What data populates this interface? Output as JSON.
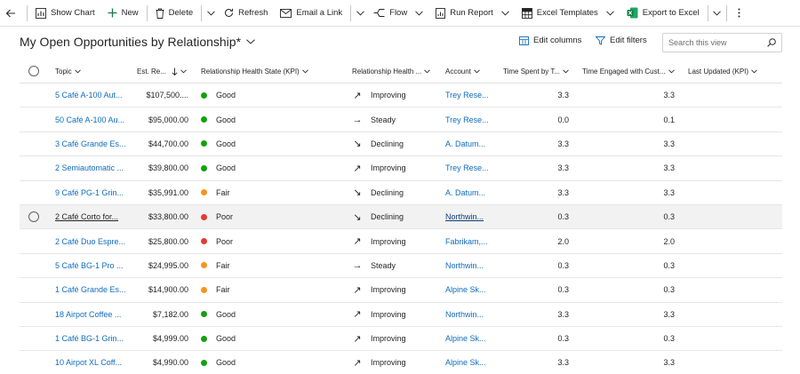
{
  "toolbar": {
    "show_chart": "Show Chart",
    "new": "New",
    "delete": "Delete",
    "refresh": "Refresh",
    "email_link": "Email a Link",
    "flow": "Flow",
    "run_report": "Run Report",
    "excel_templates": "Excel Templates",
    "export_excel": "Export to Excel"
  },
  "header": {
    "title": "My Open Opportunities by Relationship*",
    "edit_columns": "Edit columns",
    "edit_filters": "Edit filters",
    "search_placeholder": "Search this view"
  },
  "columns": {
    "topic": "Topic",
    "est_revenue": "Est. Re...",
    "health_state": "Relationship Health State (KPI)",
    "health_trend": "Relationship Health ...",
    "account": "Account",
    "time_spent": "Time Spent by T...",
    "time_engaged": "Time Engaged with Cust...",
    "last_updated": "Last Updated (KPI)"
  },
  "colors": {
    "good": "#13a10e",
    "fair": "#f7941d",
    "poor": "#e53935",
    "link": "#0f6cbd",
    "excel_green": "#107c41"
  },
  "rows": [
    {
      "topic": "5 Café A-100 Aut...",
      "revenue": "$107,500....",
      "health": "Good",
      "health_color": "#13a10e",
      "trend_icon": "↗",
      "trend": "Improving",
      "account": "Trey Rese...",
      "spent": "3.3",
      "engaged": "3.3",
      "updated": ""
    },
    {
      "topic": "50 Café A-100 Au...",
      "revenue": "$95,000.00",
      "health": "Good",
      "health_color": "#13a10e",
      "trend_icon": "→",
      "trend": "Steady",
      "account": "Trey Rese...",
      "spent": "0.0",
      "engaged": "0.1",
      "updated": ""
    },
    {
      "topic": "3 Café Grande Es...",
      "revenue": "$44,700.00",
      "health": "Good",
      "health_color": "#13a10e",
      "trend_icon": "↘",
      "trend": "Declining",
      "account": "A. Datum...",
      "spent": "3.3",
      "engaged": "3.3",
      "updated": ""
    },
    {
      "topic": "2 Semiautomatic ...",
      "revenue": "$39,800.00",
      "health": "Good",
      "health_color": "#13a10e",
      "trend_icon": "↗",
      "trend": "Improving",
      "account": "Trey Rese...",
      "spent": "3.3",
      "engaged": "3.3",
      "updated": ""
    },
    {
      "topic": "9 Café PG-1 Grin...",
      "revenue": "$35,991.00",
      "health": "Fair",
      "health_color": "#f7941d",
      "trend_icon": "↘",
      "trend": "Declining",
      "account": "A. Datum...",
      "spent": "3.3",
      "engaged": "3.3",
      "updated": ""
    },
    {
      "topic": "2 Café Corto for...",
      "revenue": "$33,800.00",
      "health": "Poor",
      "health_color": "#e53935",
      "trend_icon": "↘",
      "trend": "Declining",
      "account": "Northwin...",
      "spent": "0.3",
      "engaged": "0.3",
      "updated": ""
    },
    {
      "topic": "2 Café Duo Espre...",
      "revenue": "$25,800.00",
      "health": "Poor",
      "health_color": "#e53935",
      "trend_icon": "↗",
      "trend": "Improving",
      "account": "Fabrikam,...",
      "spent": "2.0",
      "engaged": "2.0",
      "updated": ""
    },
    {
      "topic": "5 Café BG-1 Pro ...",
      "revenue": "$24,995.00",
      "health": "Fair",
      "health_color": "#f7941d",
      "trend_icon": "→",
      "trend": "Steady",
      "account": "Northwin...",
      "spent": "0.3",
      "engaged": "0.3",
      "updated": ""
    },
    {
      "topic": "1 Café Grande Es...",
      "revenue": "$14,900.00",
      "health": "Fair",
      "health_color": "#f7941d",
      "trend_icon": "↗",
      "trend": "Improving",
      "account": "Alpine Sk...",
      "spent": "0.3",
      "engaged": "0.3",
      "updated": ""
    },
    {
      "topic": "18 Airpot Coffee ...",
      "revenue": "$7,182.00",
      "health": "Good",
      "health_color": "#13a10e",
      "trend_icon": "↗",
      "trend": "Improving",
      "account": "Northwin...",
      "spent": "3.3",
      "engaged": "3.3",
      "updated": ""
    },
    {
      "topic": "1 Café BG-1 Grin...",
      "revenue": "$4,999.00",
      "health": "Good",
      "health_color": "#13a10e",
      "trend_icon": "↗",
      "trend": "Improving",
      "account": "Alpine Sk...",
      "spent": "0.3",
      "engaged": "0.3",
      "updated": ""
    },
    {
      "topic": "10 Airpot XL Coff...",
      "revenue": "$4,990.00",
      "health": "Good",
      "health_color": "#13a10e",
      "trend_icon": "↗",
      "trend": "Improving",
      "account": "Alpine Sk...",
      "spent": "3.3",
      "engaged": "3.3",
      "updated": ""
    }
  ],
  "hovered_row_index": 5
}
